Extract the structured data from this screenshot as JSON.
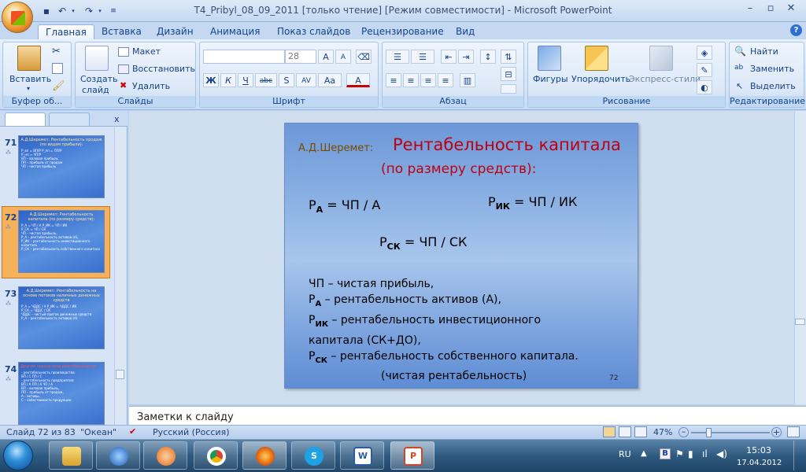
{
  "window": {
    "title": "T4_Pribyl_08_09_2011 [только чтение] [Режим совместимости] - Microsoft PowerPoint"
  },
  "ribbon": {
    "tabs": [
      "Главная",
      "Вставка",
      "Дизайн",
      "Анимация",
      "Показ слайдов",
      "Рецензирование",
      "Вид"
    ],
    "active_tab": "Главная",
    "groups": {
      "clipboard": {
        "label": "Буфер об...",
        "paste": "Вставить"
      },
      "slides": {
        "label": "Слайды",
        "new_slide_line1": "Создать",
        "new_slide_line2": "слайд",
        "layout": "Макет",
        "reset": "Восстановить",
        "delete": "Удалить"
      },
      "font": {
        "label": "Шрифт",
        "font_name": "",
        "font_size": "28"
      },
      "paragraph": {
        "label": "Абзац"
      },
      "drawing": {
        "label": "Рисование",
        "shapes": "Фигуры",
        "arrange": "Упорядочить",
        "quick_styles": "Экспресс-стили"
      },
      "editing": {
        "label": "Редактирование",
        "find": "Найти",
        "replace": "Заменить",
        "select": "Выделить"
      }
    }
  },
  "thumbnails": [
    {
      "num": "71",
      "title": "А.Д.Шеремет: Рентабельность продаж (по видам прибыли):",
      "lines": [
        "Р_вп = ВП/Р    Р_пп = ПП/Р",
        "Р_нп = ЧП/Р",
        "ВП – валовая прибыль",
        "ПП – прибыль от продаж",
        "ЧП – чистая прибыль"
      ]
    },
    {
      "num": "72",
      "title": "А.Д.Шеремет: Рентабельность капитала (по размеру средств):",
      "lines": [
        "Р_А = ЧП / А    Р_ИК = ЧП / ИК",
        "Р_СК = ЧП / СК",
        "ЧП – чистая прибыль,",
        "Р_А – рентабельность активов (А),",
        "Р_ИК – рентабельность инвестиционного капитала",
        "Р_СК – рентабельность собственного капитала"
      ]
    },
    {
      "num": "73",
      "title": "А.Д.Шеремет: Рентабельность на основе потоков наличных денежных средств",
      "lines": [
        "Р_А = ЧДДС / А    Р_ИК = ЧДДС / ИК",
        "Р_СК = ЧДДС / СК",
        "ЧДДС – чистый приток денежных средств",
        "Р_А – рентабельность активов (А)"
      ]
    },
    {
      "num": "74",
      "title": "Другие показатели рентабельности:",
      "lines": [
        "- рентабельность производства:",
        "  ВП / С    ПП / С",
        "- рентабельность предприятия:",
        "  ВП / А   ПП / А   ЧП / А",
        "ВП – валовая прибыль,",
        "ПП – прибыль от продаж,",
        "А – активы,",
        "С – себестоимость продукции."
      ]
    }
  ],
  "slide": {
    "author": "А.Д.Шеремет:",
    "title": "Рентабельность капитала",
    "subtitle": "(по размеру средств):",
    "formulas": {
      "ra": {
        "p": "Р",
        "sub": "А",
        "rest": " = ЧП / А"
      },
      "rik": {
        "p": "Р",
        "sub": "ИК",
        "rest": " = ЧП / ИК"
      },
      "rsk": {
        "p": "Р",
        "sub": "СК",
        "rest": " = ЧП / СК"
      }
    },
    "legend": {
      "l1": "ЧП – чистая прибыль,",
      "l2_sub": "А",
      "l2": " – рентабельность активов (А),",
      "l3_sub": "ИК",
      "l3": " – рентабельность инвестиционного",
      "l4": "капитала (СК+ДО),",
      "l5_sub": "СК",
      "l5": " – рентабельность собственного капитала.",
      "l6": "(чистая рентабельность)",
      "p": "Р"
    },
    "page_number": "72"
  },
  "notes": {
    "placeholder": "Заметки к слайду"
  },
  "status": {
    "slide_counter": "Слайд 72 из 83",
    "theme": "\"Океан\"",
    "language": "Русский (Россия)",
    "zoom": "47%"
  },
  "taskbar": {
    "lang": "RU",
    "time": "15:03",
    "date": "17.04.2012"
  },
  "colors": {
    "slide_title": "#c0000f",
    "slide_author": "#7a4a00",
    "accent": "#15428b"
  }
}
